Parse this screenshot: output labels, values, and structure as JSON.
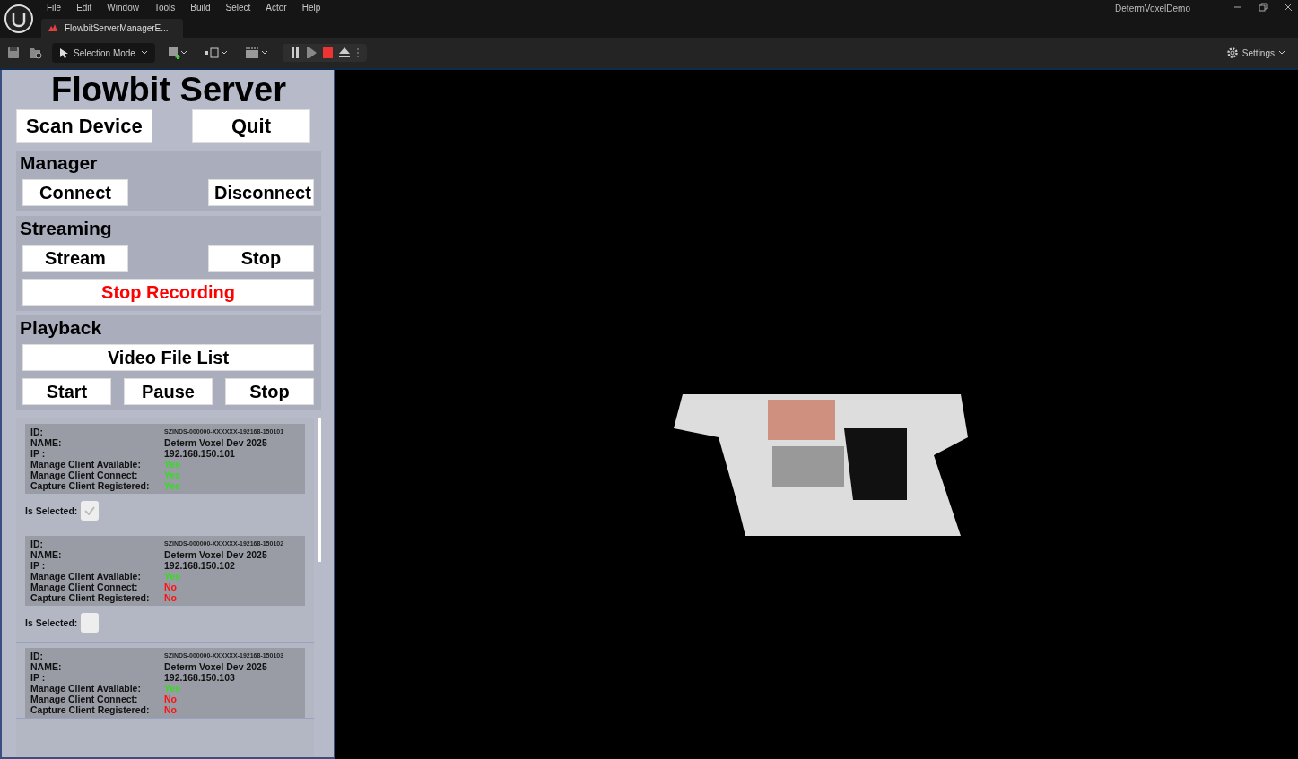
{
  "menu": [
    "File",
    "Edit",
    "Window",
    "Tools",
    "Build",
    "Select",
    "Actor",
    "Help"
  ],
  "project_title": "DetermVoxelDemo",
  "tab": {
    "label": "FlowbitServerManagerE..."
  },
  "toolbar": {
    "mode": "Selection Mode",
    "settings": "Settings"
  },
  "panel": {
    "title": "Flowbit Server",
    "top_buttons": [
      "Scan Device",
      "Quit"
    ],
    "sections": [
      {
        "title": "Manager",
        "buttons": [
          {
            "label": "Connect",
            "kind": "half",
            "danger": false
          },
          {
            "label": "Disconnect",
            "kind": "half",
            "danger": false
          }
        ]
      },
      {
        "title": "Streaming",
        "buttons": [
          {
            "label": "Stream",
            "kind": "half",
            "danger": false
          },
          {
            "label": "Stop",
            "kind": "half",
            "danger": false
          },
          {
            "label": "Stop Recording",
            "kind": "full",
            "danger": true
          }
        ]
      },
      {
        "title": "Playback",
        "buttons": [
          {
            "label": "Video File List",
            "kind": "full",
            "danger": false
          },
          {
            "label": "Start",
            "kind": "third",
            "danger": false
          },
          {
            "label": "Pause",
            "kind": "third",
            "danger": false
          },
          {
            "label": "Stop",
            "kind": "third",
            "danger": false
          }
        ]
      }
    ],
    "devices": [
      {
        "fields": [
          {
            "label": "ID:",
            "value": "SZINDS-000000-XXXXXX-192168-150101",
            "kind": "id"
          },
          {
            "label": "NAME:",
            "value": "Determ Voxel Dev 2025",
            "kind": "text"
          },
          {
            "label": "IP :",
            "value": "192.168.150.101",
            "kind": "text"
          },
          {
            "label": "Manage Client Available:",
            "value": "Yes",
            "kind": "status",
            "ok": true
          },
          {
            "label": "Manage Client Connect:",
            "value": "Yes",
            "kind": "status",
            "ok": true
          },
          {
            "label": "Capture Client Registered:",
            "value": "Yes",
            "kind": "status",
            "ok": true
          }
        ],
        "select_label": "Is Selected:",
        "checked": true
      },
      {
        "fields": [
          {
            "label": "ID:",
            "value": "SZINDS-000000-XXXXXX-192168-150102",
            "kind": "id"
          },
          {
            "label": "NAME:",
            "value": "Determ Voxel Dev 2025",
            "kind": "text"
          },
          {
            "label": "IP :",
            "value": "192.168.150.102",
            "kind": "text"
          },
          {
            "label": "Manage Client Available:",
            "value": "Yes",
            "kind": "status",
            "ok": true
          },
          {
            "label": "Manage Client Connect:",
            "value": "No",
            "kind": "status",
            "ok": false
          },
          {
            "label": "Capture Client Registered:",
            "value": "No",
            "kind": "status",
            "ok": false
          }
        ],
        "select_label": "Is Selected:",
        "checked": false
      },
      {
        "fields": [
          {
            "label": "ID:",
            "value": "SZINDS-000000-XXXXXX-192168-150103",
            "kind": "id"
          },
          {
            "label": "NAME:",
            "value": "Determ Voxel Dev 2025",
            "kind": "text"
          },
          {
            "label": "IP :",
            "value": "192.168.150.103",
            "kind": "text"
          },
          {
            "label": "Manage Client Available:",
            "value": "Yes",
            "kind": "status",
            "ok": true
          },
          {
            "label": "Manage Client Connect:",
            "value": "No",
            "kind": "status",
            "ok": false
          },
          {
            "label": "Capture Client Registered:",
            "value": "No",
            "kind": "status",
            "ok": false
          }
        ]
      }
    ]
  }
}
